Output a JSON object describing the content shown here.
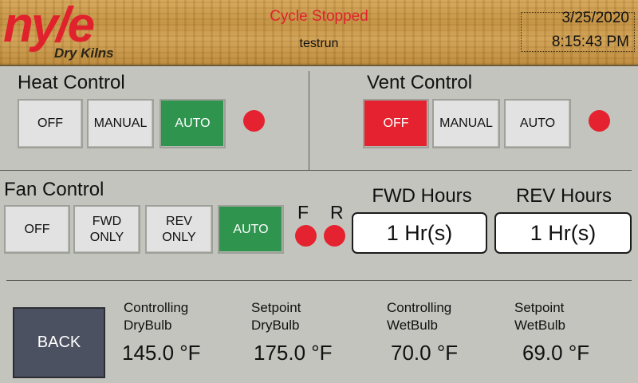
{
  "header": {
    "logo_main": "ny/e",
    "logo_sub": "Dry Kilns",
    "status": "Cycle Stopped",
    "run_name": "testrun",
    "date": "3/25/2020",
    "time": "8:15:43 PM"
  },
  "heat_control": {
    "title": "Heat Control",
    "buttons": [
      "OFF",
      "MANUAL",
      "AUTO"
    ],
    "active": "AUTO"
  },
  "vent_control": {
    "title": "Vent Control",
    "buttons": [
      "OFF",
      "MANUAL",
      "AUTO"
    ],
    "active": "OFF"
  },
  "fan_control": {
    "title": "Fan Control",
    "buttons": [
      "OFF",
      "FWD ONLY",
      "REV ONLY",
      "AUTO"
    ],
    "active": "AUTO",
    "indicator_f": "F",
    "indicator_r": "R"
  },
  "hours": {
    "fwd_title": "FWD Hours",
    "fwd_value": "1 Hr(s)",
    "rev_title": "REV Hours",
    "rev_value": "1 Hr(s)"
  },
  "back_label": "BACK",
  "readings": [
    {
      "label_line1": "Controlling",
      "label_line2": "DryBulb",
      "value": "145.0 °F"
    },
    {
      "label_line1": "Setpoint",
      "label_line2": "DryBulb",
      "value": "175.0 °F"
    },
    {
      "label_line1": "Controlling",
      "label_line2": "WetBulb",
      "value": "70.0 °F"
    },
    {
      "label_line1": "Setpoint",
      "label_line2": "WetBulb",
      "value": "69.0 °F"
    }
  ],
  "colors": {
    "active_green": "#2e944e",
    "active_red": "#e5222f",
    "indicator_red": "#e5222f",
    "background": "#c3c4bd"
  }
}
